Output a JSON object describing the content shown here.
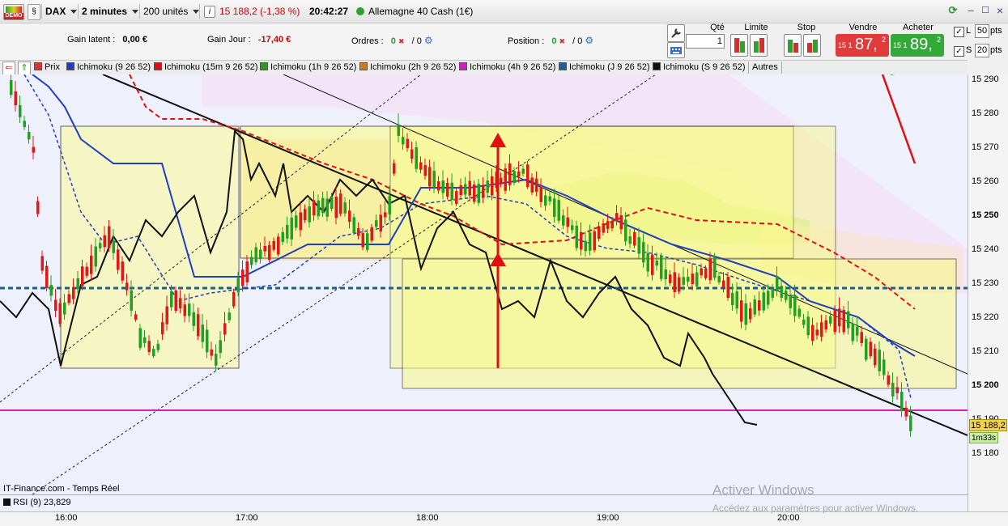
{
  "toolbar": {
    "demo_badge": "DEMO",
    "instrument": "DAX",
    "timeframe": "2 minutes",
    "units": "200 unités",
    "info_badge": "i",
    "price_change": "15 188,2 (-1,38 %)",
    "time": "20:42:27",
    "instrument_full": "Allemagne 40 Cash (1€)"
  },
  "info": {
    "gain_latent_label": "Gain latent :",
    "gain_latent_value": "0,00 €",
    "gain_jour_label": "Gain Jour :",
    "gain_jour_value": "-17,40 €",
    "ordres_label": "Ordres :",
    "ordres_count": "0",
    "ordres_sep": "/ 0",
    "position_label": "Position :",
    "position_count": "0",
    "position_sep": "/ 0"
  },
  "order_panel": {
    "qte_label": "Qté",
    "qte_value": "1",
    "limite_label": "Limite",
    "stop_label": "Stop",
    "vendre_label": "Vendre",
    "vendre_prefix": "15 1",
    "vendre_big": "87,",
    "vendre_small": "2",
    "acheter_label": "Acheter",
    "acheter_prefix": "15 1",
    "acheter_big": "89,",
    "acheter_small": "2",
    "l_label": "L",
    "l_value": "50",
    "l_unit": "pts",
    "s_label": "S",
    "s_value": "20",
    "s_unit": "pts"
  },
  "indicators": [
    {
      "label": "Prix",
      "color": "#e03030"
    },
    {
      "label": "Ichimoku (9 26 52)",
      "color": "#1f3fbf"
    },
    {
      "label": "Ichimoku (15m 9 26 52)",
      "color": "#e01010"
    },
    {
      "label": "Ichimoku (1h 9 26 52)",
      "color": "#2f9a1f"
    },
    {
      "label": "Ichimoku (2h 9 26 52)",
      "color": "#d07a20"
    },
    {
      "label": "Ichimoku (4h 9 26 52)",
      "color": "#d020c0"
    },
    {
      "label": "Ichimoku (J 9 26 52)",
      "color": "#1f5fa0"
    },
    {
      "label": "Ichimoku (S 9 26 52)",
      "color": "#111111"
    }
  ],
  "autres_label": "Autres",
  "y_ticks": [
    "15 290",
    "15 280",
    "15 270",
    "15 260",
    "15 250",
    "15 240",
    "15 230",
    "15 220",
    "15 210",
    "15 200",
    "15 190",
    "15 180"
  ],
  "current_price_label": "15 188,2",
  "countdown_label": "1m33s",
  "x_ticks": [
    "16:00",
    "17:00",
    "18:00",
    "19:00",
    "20:00"
  ],
  "source_label": "IT-Finance.com - Temps Réel",
  "rsi_label": "RSI (9) 23,829",
  "watermark_title": "Activer Windows",
  "watermark_sub": "Accédez aux paramètres pour activer Windows.",
  "colors": {
    "sell": "#e03a3a",
    "buy": "#35a83a",
    "up_candle": "#22a022",
    "down_candle": "#e01818",
    "magenta_line": "#d020c0",
    "price_tag": "#f2d24b",
    "countdown_tag": "#c8f0a0"
  }
}
